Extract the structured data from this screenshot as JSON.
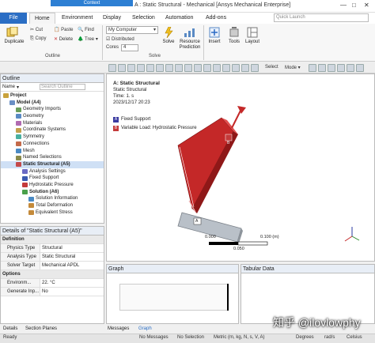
{
  "titlebar": {
    "context_tab": "Context",
    "title": "A : Static Structural - Mechanical [Ansys Mechanical Enterprise]",
    "controls": [
      "—",
      "□",
      "✕"
    ]
  },
  "ribbon_tabs": {
    "file": "File",
    "home": "Home",
    "environment": "Environment",
    "display": "Display",
    "selection": "Selection",
    "automation": "Automation",
    "addons": "Add-ons",
    "search_placeholder": "Quick Launch"
  },
  "ribbon": {
    "duplicate": "Duplicate",
    "cut": "Cut",
    "copy": "Copy",
    "paste": "Paste",
    "delete": "Delete",
    "find": "Find",
    "tree": "Tree",
    "outline_group": "Outline",
    "computer": "My Computer",
    "distributed": "Distributed",
    "cores_label": "Cores",
    "cores_value": "4",
    "solve": "Solve",
    "resource_prediction": "Resource Prediction",
    "solve_group": "Solve",
    "insert": "Insert",
    "tools": "Tools",
    "layout": "Layout"
  },
  "toolbar2": {
    "select": "Select",
    "mode": "Mode"
  },
  "outline": {
    "header": "Outline",
    "name_label": "Name",
    "search_placeholder": "Search Outline",
    "items": [
      {
        "label": "Project",
        "indent": 0,
        "color": "#c9a23c",
        "bold": true
      },
      {
        "label": "Model (A4)",
        "indent": 1,
        "color": "#6a8fc4",
        "bold": true
      },
      {
        "label": "Geometry Imports",
        "indent": 2,
        "color": "#6a9e5a",
        "bold": false
      },
      {
        "label": "Geometry",
        "indent": 2,
        "color": "#5a8ac4",
        "bold": false
      },
      {
        "label": "Materials",
        "indent": 2,
        "color": "#b06ab0",
        "bold": false
      },
      {
        "label": "Coordinate Systems",
        "indent": 2,
        "color": "#c4a04a",
        "bold": false
      },
      {
        "label": "Symmetry",
        "indent": 2,
        "color": "#4ab0a0",
        "bold": false
      },
      {
        "label": "Connections",
        "indent": 2,
        "color": "#c46a4a",
        "bold": false
      },
      {
        "label": "Mesh",
        "indent": 2,
        "color": "#4a8ac4",
        "bold": false
      },
      {
        "label": "Named Selections",
        "indent": 2,
        "color": "#8a8a4a",
        "bold": false
      },
      {
        "label": "Static Structural (A5)",
        "indent": 2,
        "color": "#c44a4a",
        "bold": true
      },
      {
        "label": "Analysis Settings",
        "indent": 3,
        "color": "#6a6ac4",
        "bold": false
      },
      {
        "label": "Fixed Support",
        "indent": 3,
        "color": "#3a5ab0",
        "bold": false
      },
      {
        "label": "Hydrostatic Pressure",
        "indent": 3,
        "color": "#c43a3a",
        "bold": false
      },
      {
        "label": "Solution (A6)",
        "indent": 3,
        "color": "#4aa04a",
        "bold": true
      },
      {
        "label": "Solution Information",
        "indent": 4,
        "color": "#4a8ac4",
        "bold": false
      },
      {
        "label": "Total Deformation",
        "indent": 4,
        "color": "#c48a3a",
        "bold": false
      },
      {
        "label": "Equivalent Stress",
        "indent": 4,
        "color": "#c48a3a",
        "bold": false
      }
    ]
  },
  "details": {
    "header": "Details of \"Static Structural (A5)\"",
    "sec_definition": "Definition",
    "rows_definition": [
      {
        "k": "Physics Type",
        "v": "Structural"
      },
      {
        "k": "Analysis Type",
        "v": "Static Structural"
      },
      {
        "k": "Solver Target",
        "v": "Mechanical APDL"
      }
    ],
    "sec_options": "Options",
    "rows_options": [
      {
        "k": "Environm...",
        "v": "22. °C"
      },
      {
        "k": "Generate Inp...",
        "v": "No"
      }
    ]
  },
  "viewport": {
    "title": "A: Static Structural",
    "subtitle": "Static Structural",
    "time": "Time: 1. s",
    "date": "2023/12/17 20:23",
    "legend": [
      {
        "tag": "A",
        "label": "Fixed Support",
        "color": "#3a3aa0"
      },
      {
        "tag": "B",
        "label": "Variable Load: Hydrostatic Pressure",
        "color": "#c43a3a"
      }
    ],
    "scale_left": "0.000",
    "scale_right": "0.100 (m)",
    "scale_mid": "0.050",
    "tag_a": "A",
    "tag_b": "B"
  },
  "graph": {
    "header": "Graph"
  },
  "tabular": {
    "header": "Tabular Data"
  },
  "bottom_tabs": {
    "details": "Details",
    "section_planes": "Section Planes",
    "messages": "Messages",
    "graph": "Graph"
  },
  "status": {
    "ready": "Ready",
    "messages": "No Messages",
    "selection": "No Selection",
    "units": "Metric (m, kg, N, s, V, A)",
    "degrees": "Degrees",
    "rads": "rad/s",
    "celsius": "Celsius"
  },
  "watermark": "知乎 @ilovlowphy"
}
